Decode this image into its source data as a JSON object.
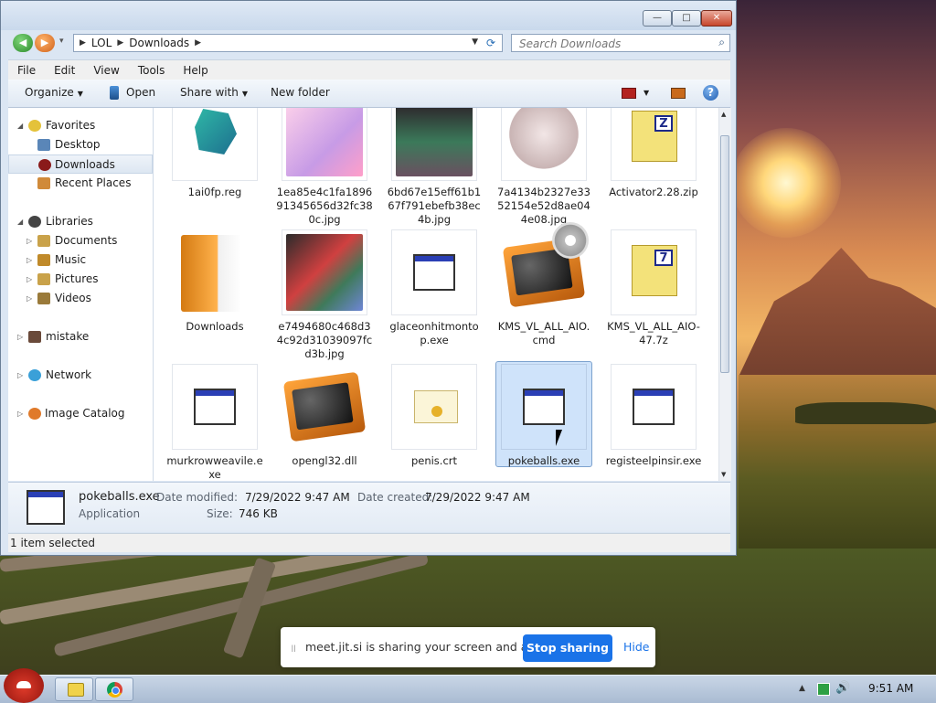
{
  "explorer": {
    "nav": {
      "back_arrow": "◀",
      "forward_arrow": "▶",
      "dropdown_glyph": "▾",
      "breadcrumb": [
        "LOL",
        "Downloads"
      ],
      "refresh_glyph": "⟳"
    },
    "search": {
      "placeholder": "Search Downloads",
      "icon": "search-icon"
    },
    "window_controls": {
      "minimize": "—",
      "maximize": "□",
      "close": "✕"
    },
    "menu": [
      "File",
      "Edit",
      "View",
      "Tools",
      "Help"
    ],
    "toolbar": {
      "organize": "Organize",
      "open": "Open",
      "share_with": "Share with",
      "new_folder": "New folder",
      "help_glyph": "?"
    },
    "nav_pane": {
      "favorites": {
        "label": "Favorites",
        "items": [
          "Desktop",
          "Downloads",
          "Recent Places"
        ],
        "selected": "Downloads"
      },
      "libraries": {
        "label": "Libraries",
        "items": [
          "Documents",
          "Music",
          "Pictures",
          "Videos"
        ]
      },
      "other": [
        "mistake",
        "Network",
        "Image Catalog"
      ]
    },
    "files": [
      {
        "name": "1ai0fp.reg",
        "kind": "reg"
      },
      {
        "name": "1ea85e4c1fa189691345656d32fc380c.jpg",
        "kind": "image"
      },
      {
        "name": "6bd67e15eff61b167f791ebefb38ec4b.jpg",
        "kind": "image"
      },
      {
        "name": "7a4134b2327e3352154e52d8ae044e08.jpg",
        "kind": "image"
      },
      {
        "name": "Activator2.28.zip",
        "kind": "zip",
        "tag": "Z"
      },
      {
        "name": "Downloads",
        "kind": "folder"
      },
      {
        "name": "e7494680c468d34c92d31039097fcd3b.jpg",
        "kind": "image"
      },
      {
        "name": "glaceonhitmontop.exe",
        "kind": "exe"
      },
      {
        "name": "KMS_VL_ALL_AIO.cmd",
        "kind": "cmd"
      },
      {
        "name": "KMS_VL_ALL_AIO-47.7z",
        "kind": "zip",
        "tag": "7"
      },
      {
        "name": "murkrowweavile.exe",
        "kind": "exe"
      },
      {
        "name": "opengl32.dll",
        "kind": "dll"
      },
      {
        "name": "penis.crt",
        "kind": "crt"
      },
      {
        "name": "pokeballs.exe",
        "kind": "exe",
        "selected": true
      },
      {
        "name": "registeelpinsir.exe",
        "kind": "exe"
      }
    ],
    "details": {
      "name": "pokeballs.exe",
      "type": "Application",
      "date_modified_label": "Date modified:",
      "date_modified": "7/29/2022 9:47 AM",
      "date_created_label": "Date created:",
      "date_created": "7/29/2022 9:47 AM",
      "size_label": "Size:",
      "size": "746 KB"
    },
    "status": "1 item selected"
  },
  "share_banner": {
    "grip": "॥",
    "message": "meet.jit.si is sharing your screen and audio.",
    "stop": "Stop sharing",
    "hide": "Hide"
  },
  "taskbar": {
    "tray_arrow": "▲",
    "volume_glyph": "🔊",
    "clock": "9:51 AM"
  }
}
